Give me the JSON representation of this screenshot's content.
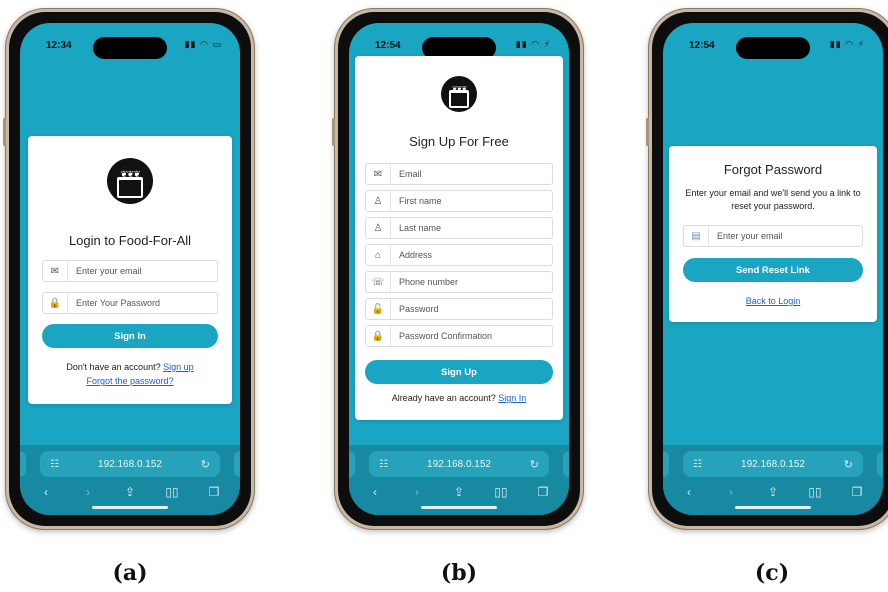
{
  "phones": [
    {
      "caption": "(a)",
      "time": "12:34",
      "url": "192.168.0.152",
      "login": {
        "title": "Login to Food-For-All",
        "email_placeholder": "Enter your email",
        "password_placeholder": "Enter Your Password",
        "signin_label": "Sign In",
        "no_account_text": "Don't have an account?",
        "signup_link": "Sign up",
        "forgot_link": "Forgot the password?"
      }
    },
    {
      "caption": "(b)",
      "time": "12:54",
      "url": "192.168.0.152",
      "signup": {
        "title": "Sign Up For Free",
        "fields": [
          {
            "icon": "envelope-icon",
            "glyph": "✉",
            "placeholder": "Email"
          },
          {
            "icon": "user-icon",
            "glyph": "♙",
            "placeholder": "First name"
          },
          {
            "icon": "user-icon",
            "glyph": "♙",
            "placeholder": "Last name"
          },
          {
            "icon": "home-icon",
            "glyph": "⌂",
            "placeholder": "Address"
          },
          {
            "icon": "phone-icon",
            "glyph": "☏",
            "placeholder": "Phone number"
          },
          {
            "icon": "lock-open-icon",
            "glyph": "🔓",
            "placeholder": "Password"
          },
          {
            "icon": "lock-icon",
            "glyph": "🔒",
            "placeholder": "Password Confirmation"
          }
        ],
        "signup_label": "Sign Up",
        "have_account_text": "Already have an account?",
        "signin_link": "Sign In"
      }
    },
    {
      "caption": "(c)",
      "time": "12:54",
      "url": "192.168.0.152",
      "forgot": {
        "title": "Forgot Password",
        "description": "Enter your email and we'll send you a link to reset your password.",
        "email_placeholder": "Enter your email",
        "send_label": "Send Reset Link",
        "back_link": "Back to Login"
      }
    }
  ],
  "colors": {
    "screen_bg": "#1aa5c2",
    "accent": "#1aa5c2",
    "link": "#1a5fd0"
  }
}
